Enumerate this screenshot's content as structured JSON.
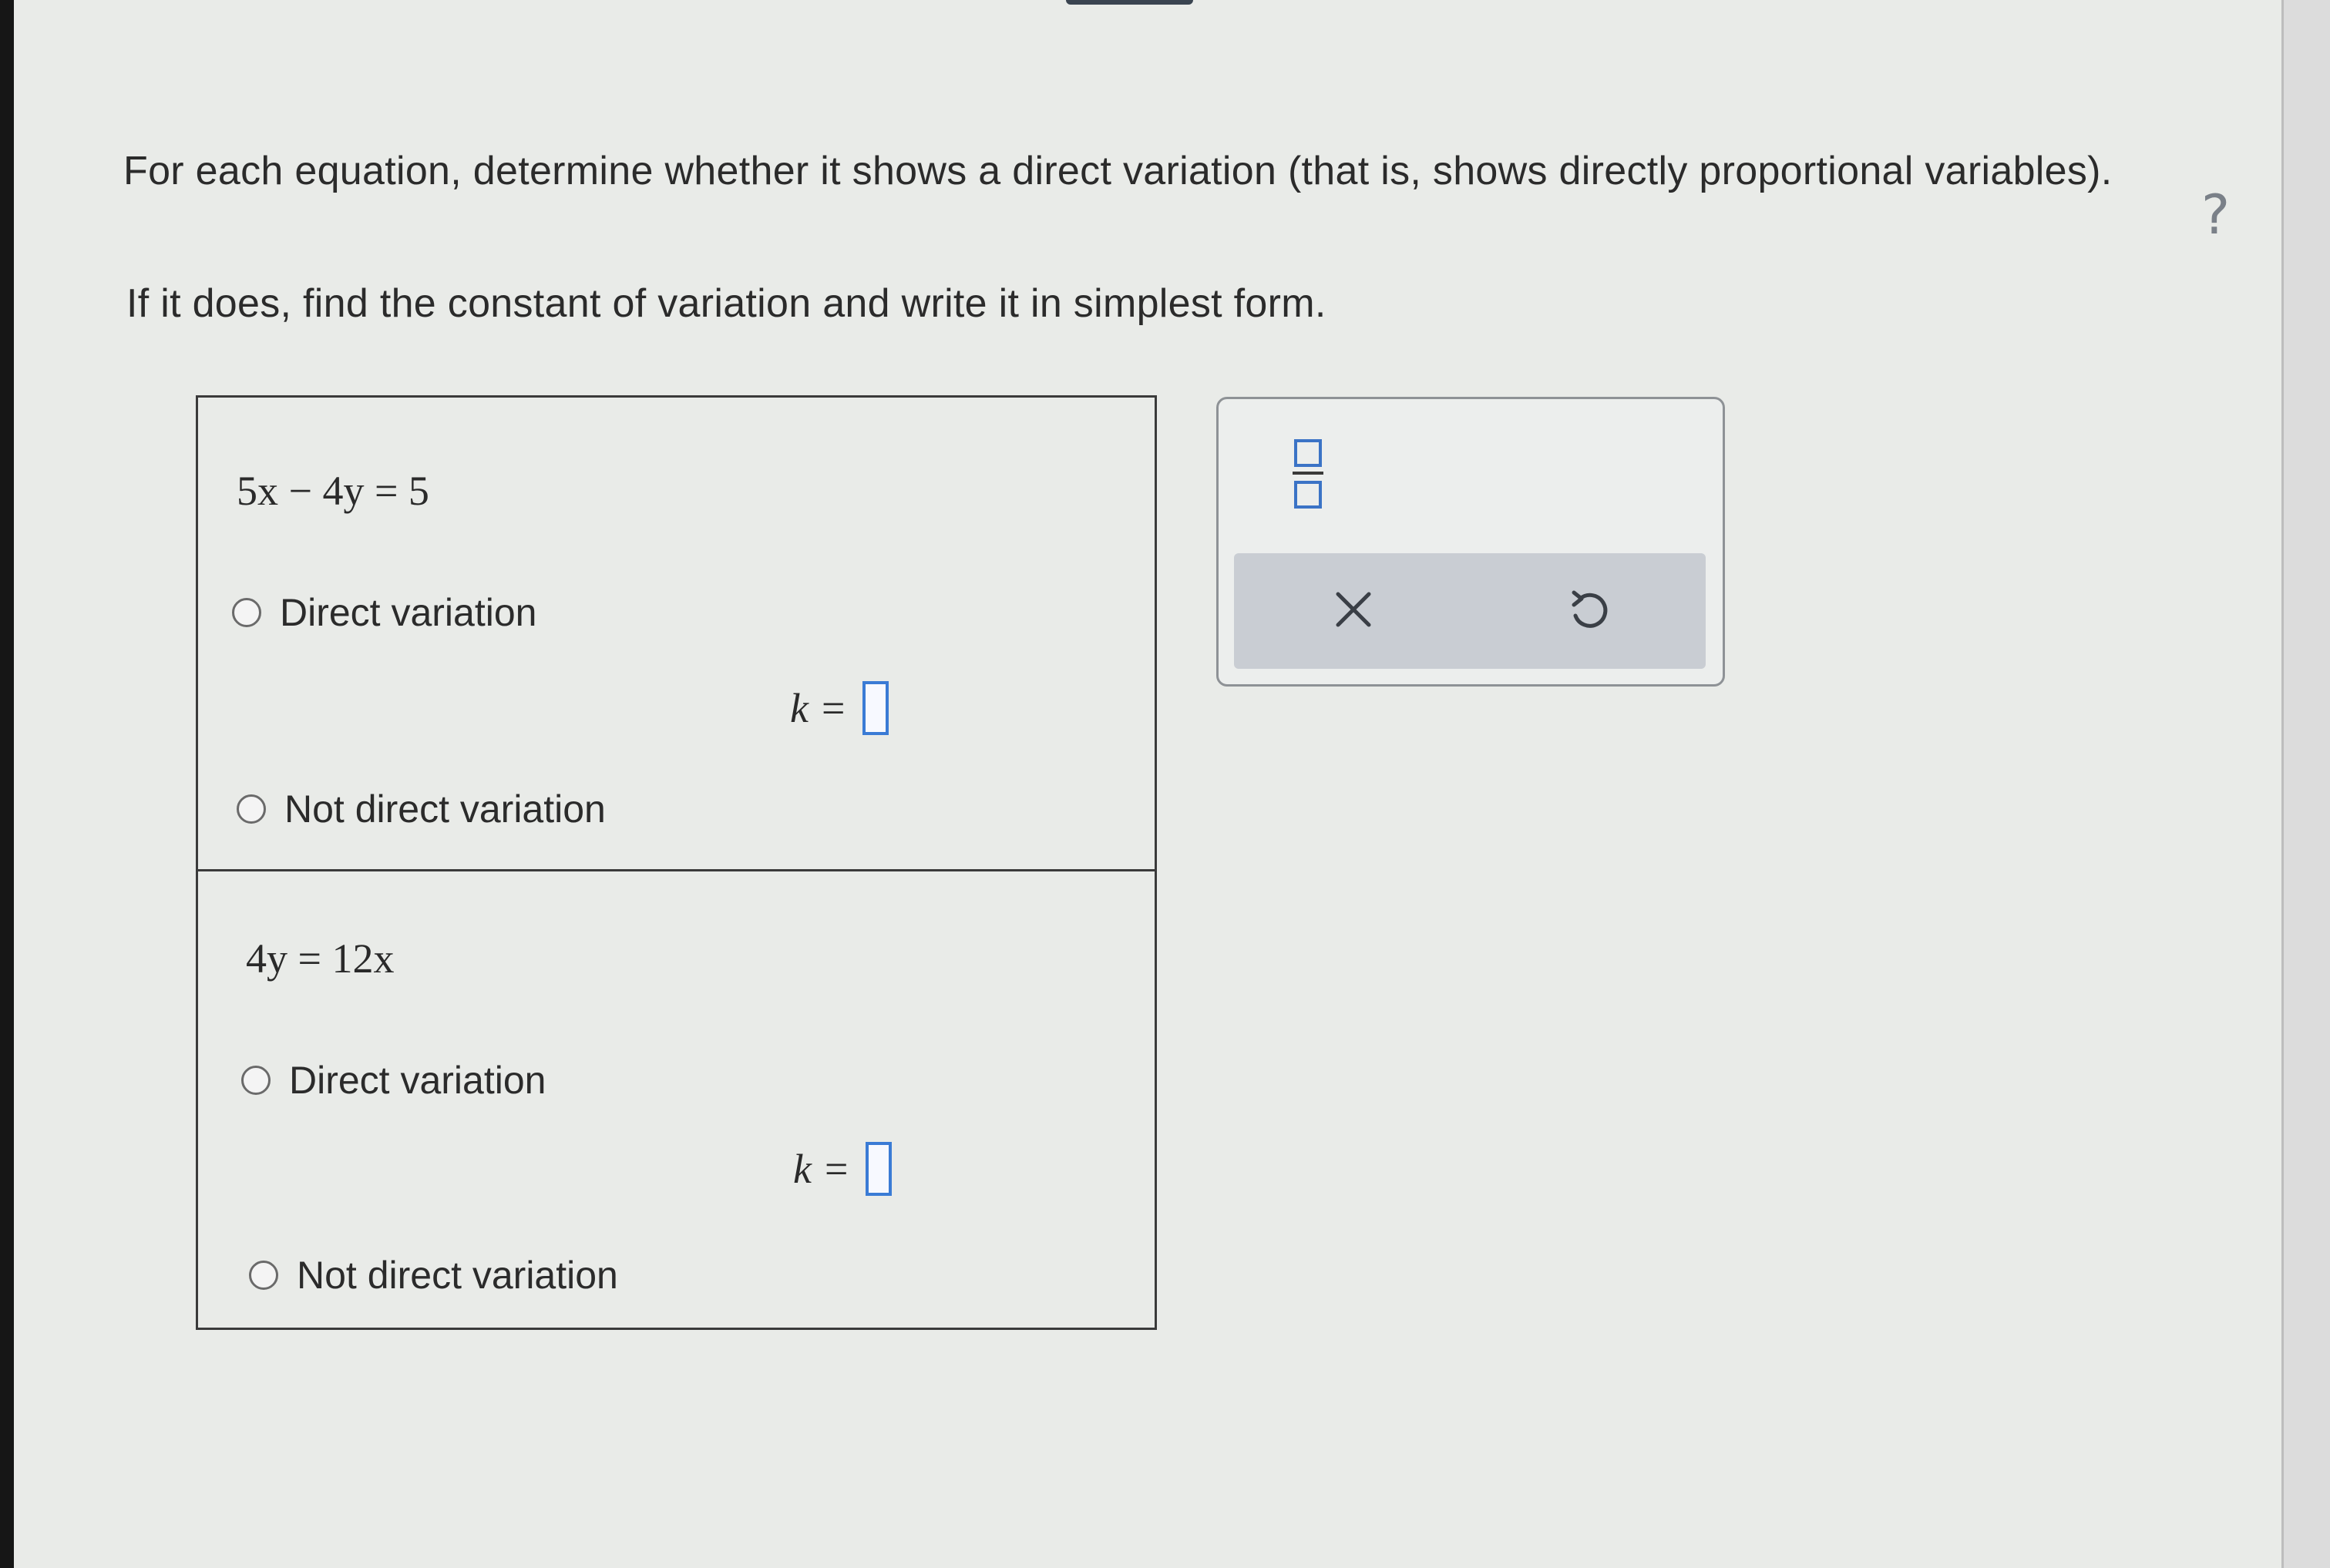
{
  "instructions": {
    "line1": "For each equation, determine whether it shows a direct variation (that is, shows directly proportional variables).",
    "line2": "If it does, find the constant of variation and write it in simplest form."
  },
  "help_icon": "?",
  "problems": [
    {
      "equation": "5x − 4y = 5",
      "option_direct": "Direct variation",
      "k_label": "k =",
      "option_not_direct": "Not direct variation"
    },
    {
      "equation": "4y = 12x",
      "option_direct": "Direct variation",
      "k_label": "k =",
      "option_not_direct": "Not direct variation"
    }
  ],
  "tools": {
    "icons": [
      "fraction-icon",
      "clear-icon",
      "undo-icon"
    ]
  },
  "colors": {
    "accent": "#3a7bd5",
    "text": "#2b2b2b",
    "toolbar": "#c9cdd3"
  }
}
